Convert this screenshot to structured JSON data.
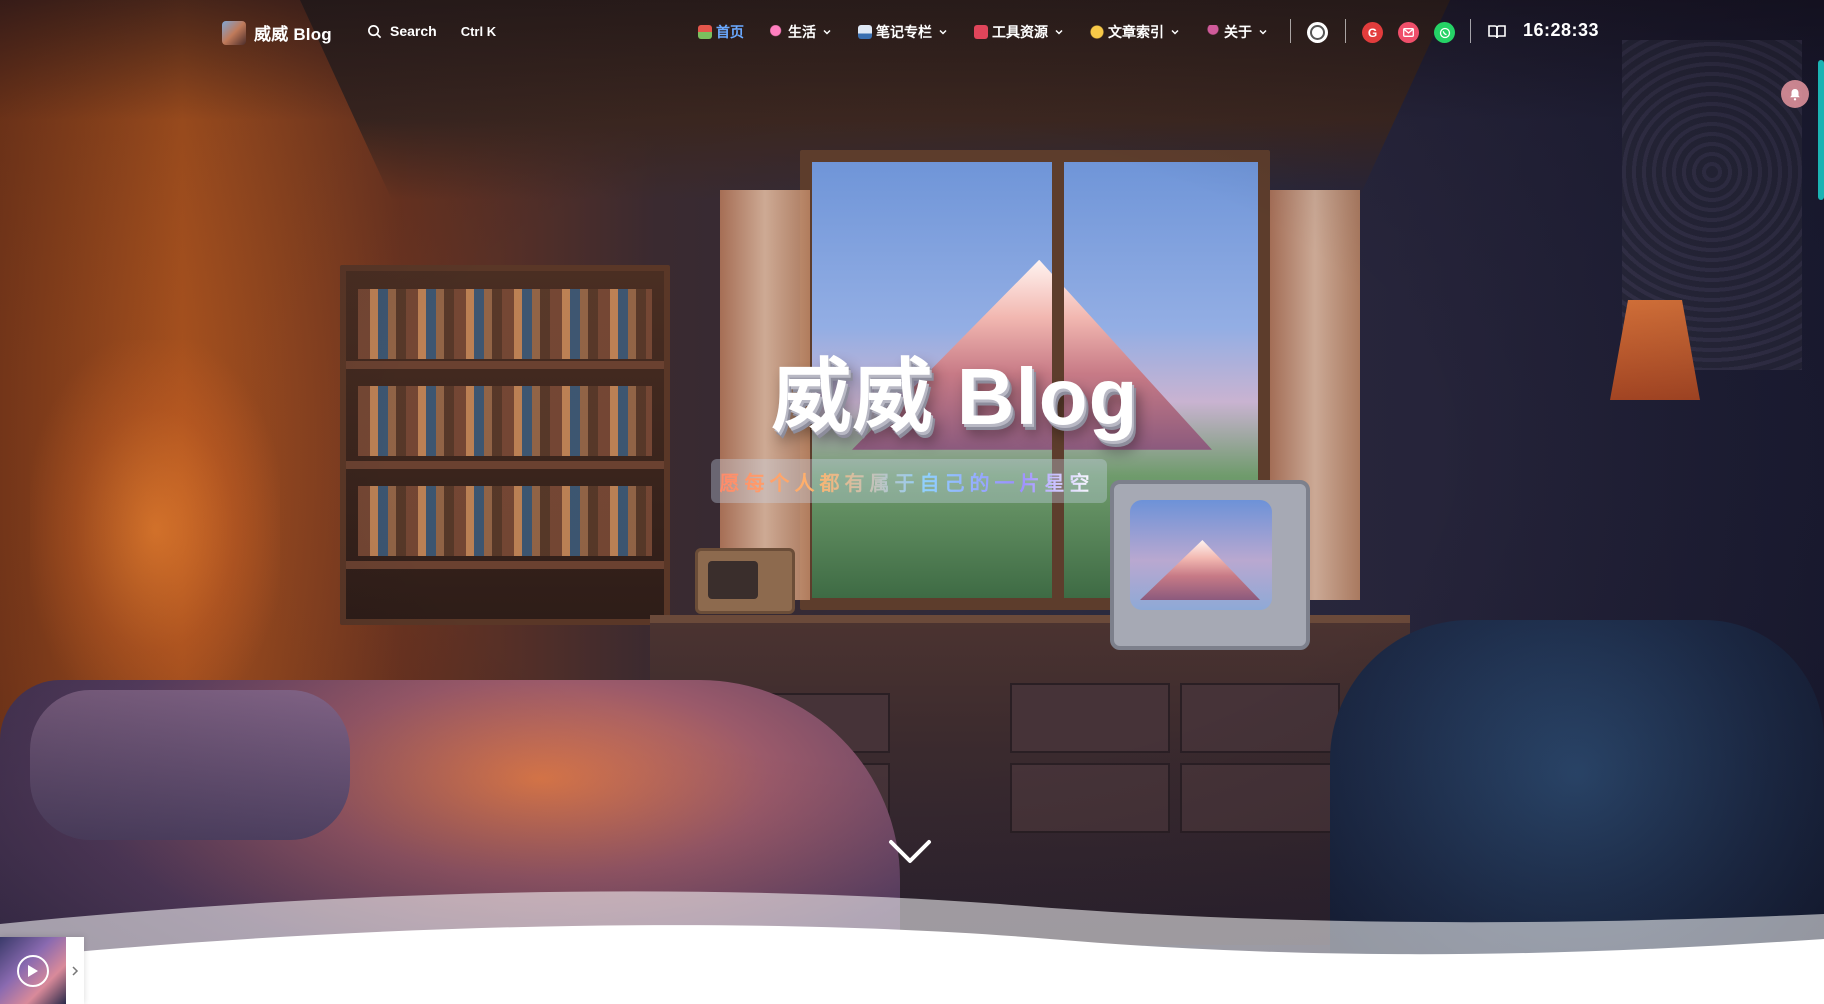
{
  "brand": {
    "name": "威威 Blog"
  },
  "search": {
    "label": "Search",
    "shortcut": "Ctrl K"
  },
  "menu": [
    {
      "label": "首页",
      "icon": "house-emoji",
      "active": true,
      "dropdown": false
    },
    {
      "label": "生活",
      "icon": "lollipop-emoji",
      "dropdown": true
    },
    {
      "label": "笔记专栏",
      "icon": "notebook-emoji",
      "dropdown": true
    },
    {
      "label": "工具资源",
      "icon": "toolbox-emoji",
      "dropdown": true
    },
    {
      "label": "文章索引",
      "icon": "clap-emoji",
      "dropdown": true
    },
    {
      "label": "关于",
      "icon": "wine-glass-emoji",
      "dropdown": true
    }
  ],
  "social": {
    "g_label": "G"
  },
  "clock": {
    "time": "16:28:33"
  },
  "hero": {
    "title": "威威 Blog",
    "subtitle": "愿每个人都有属于自己的一片星空"
  },
  "colors": {
    "active_menu": "#6aa9ff",
    "social_g": "#e23c3c",
    "social_mail": "#f04f6a",
    "social_whatsapp": "#25d366"
  }
}
